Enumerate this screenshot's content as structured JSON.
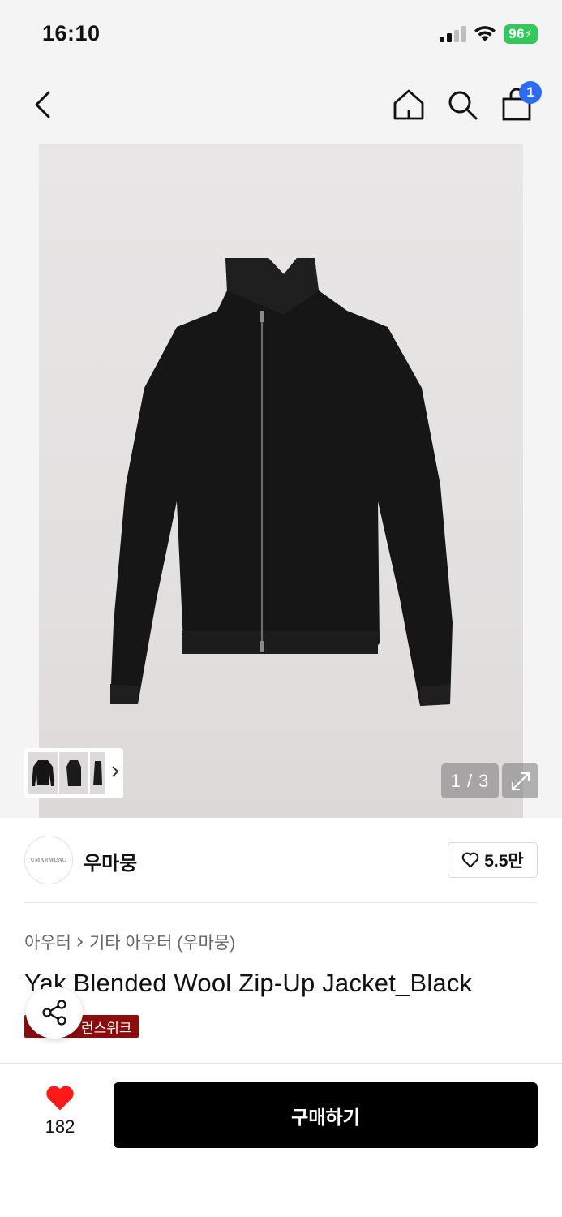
{
  "status_bar": {
    "time": "16:10",
    "battery": "96"
  },
  "nav": {
    "cart_count": "1"
  },
  "gallery": {
    "counter": "1 / 3"
  },
  "brand": {
    "logo_text": "UMARMUNG",
    "name": "우마뭉",
    "likes": "5.5만"
  },
  "breadcrumb": {
    "category": "아우터",
    "subcategory": "기타 아우터 (우마뭉)"
  },
  "product": {
    "title": "Yak Blended Wool Zip-Up Jacket_Black",
    "tag": "런스위크"
  },
  "bottom_bar": {
    "like_count": "182",
    "buy_label": "구매하기"
  },
  "colors": {
    "accent": "#2d6bf5",
    "heart": "#ff1a1a",
    "tag": "#8b0d0d",
    "battery": "#34c759"
  }
}
